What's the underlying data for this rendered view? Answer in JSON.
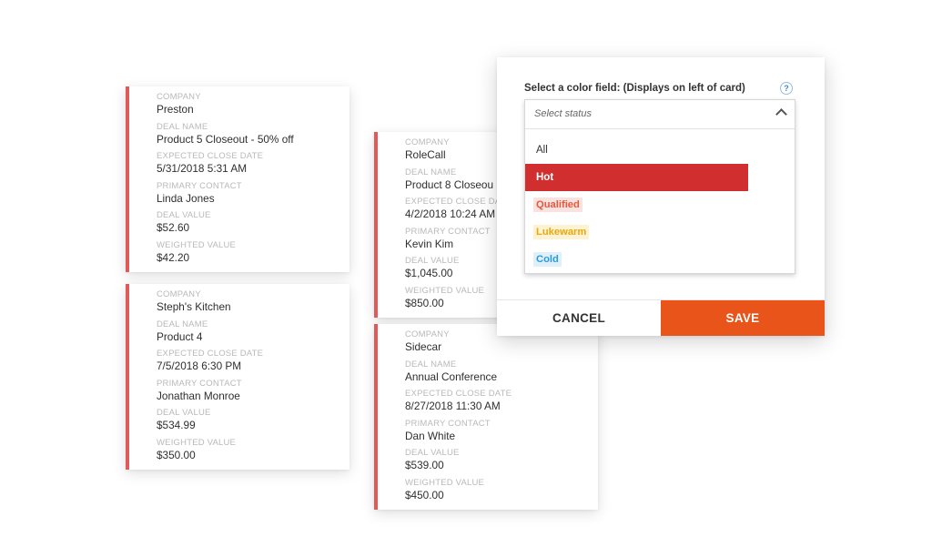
{
  "cards": [
    {
      "company_label": "COMPANY",
      "company": "Preston",
      "deal_label": "DEAL NAME",
      "deal": "Product 5 Closeout - 50% off",
      "close_label": "EXPECTED CLOSE DATE",
      "close": "5/31/2018 5:31 AM",
      "contact_label": "PRIMARY CONTACT",
      "contact": "Linda Jones",
      "value_label": "DEAL VALUE",
      "value": "$52.60",
      "weighted_label": "WEIGHTED VALUE",
      "weighted": "$42.20"
    },
    {
      "company_label": "COMPANY",
      "company": "Steph's Kitchen",
      "deal_label": "DEAL NAME",
      "deal": "Product 4",
      "close_label": "EXPECTED CLOSE DATE",
      "close": "7/5/2018 6:30 PM",
      "contact_label": "PRIMARY CONTACT",
      "contact": "Jonathan Monroe",
      "value_label": "DEAL VALUE",
      "value": "$534.99",
      "weighted_label": "WEIGHTED VALUE",
      "weighted": "$350.00"
    },
    {
      "company_label": "COMPANY",
      "company": "RoleCall",
      "deal_label": "DEAL NAME",
      "deal": "Product 8 Closeou",
      "close_label": "EXPECTED CLOSE DATE",
      "close": "4/2/2018 10:24 AM",
      "contact_label": "PRIMARY CONTACT",
      "contact": "Kevin Kim",
      "value_label": "DEAL VALUE",
      "value": "$1,045.00",
      "weighted_label": "WEIGHTED VALUE",
      "weighted": "$850.00"
    },
    {
      "company_label": "COMPANY",
      "company": "Sidecar",
      "deal_label": "DEAL NAME",
      "deal": "Annual Conference",
      "close_label": "EXPECTED CLOSE DATE",
      "close": "8/27/2018 11:30 AM",
      "contact_label": "PRIMARY CONTACT",
      "contact": "Dan White",
      "value_label": "DEAL VALUE",
      "value": "$539.00",
      "weighted_label": "WEIGHTED VALUE",
      "weighted": "$450.00"
    }
  ],
  "modal": {
    "label": "Select a color field: (Displays on left of card)",
    "help_glyph": "?",
    "placeholder": "Select status",
    "options": {
      "all": "All",
      "hot": "Hot",
      "qualified": "Qualified",
      "lukewarm": "Lukewarm",
      "cold": "Cold"
    },
    "cancel": "CANCEL",
    "save": "SAVE"
  },
  "colors": {
    "card_stripe": "#e05a5a",
    "hot": "#d12f2f",
    "qualified": "#e15a3f",
    "lukewarm": "#e6a816",
    "cold": "#2d9ad8",
    "save_button": "#e8541a"
  }
}
